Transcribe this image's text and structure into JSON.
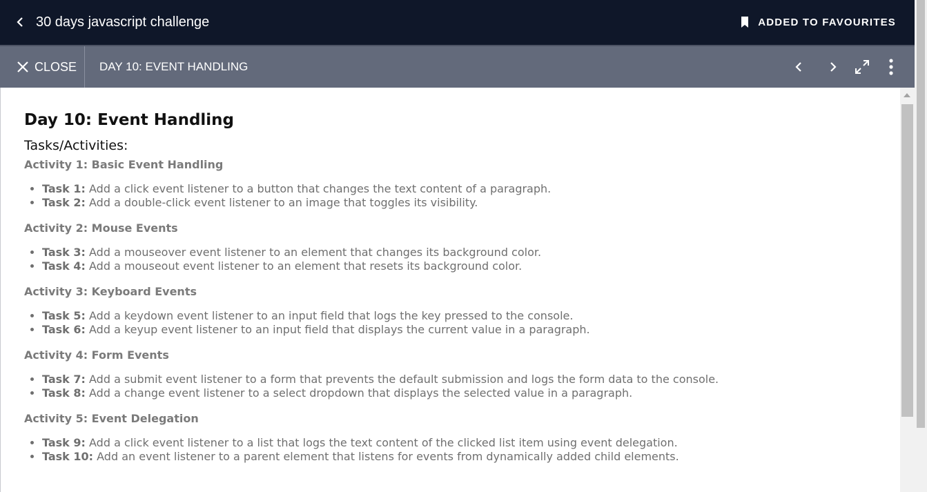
{
  "header": {
    "course_title": "30 days javascript challenge",
    "favourite_label": "ADDED TO FAVOURITES",
    "back_icon": "chevron-left-icon",
    "favourite_icon": "bookmark-icon"
  },
  "subbar": {
    "close_label": "CLOSE",
    "lesson_title": "DAY 10: EVENT HANDLING",
    "icons": [
      "chevron-left-icon",
      "chevron-right-icon",
      "expand-icon",
      "more-vertical-icon"
    ]
  },
  "content": {
    "title": "Day 10: Event Handling",
    "subtitle": "Tasks/Activities:",
    "activities": [
      {
        "heading": "Activity 1: Basic Event Handling",
        "tasks": [
          {
            "label": "Task 1:",
            "text": " Add a click event listener to a button that changes the text content of a paragraph."
          },
          {
            "label": "Task 2:",
            "text": " Add a double-click event listener to an image that toggles its visibility."
          }
        ]
      },
      {
        "heading": "Activity 2: Mouse Events",
        "tasks": [
          {
            "label": "Task 3:",
            "text": " Add a mouseover event listener to an element that changes its background color."
          },
          {
            "label": "Task 4:",
            "text": " Add a mouseout event listener to an element that resets its background color."
          }
        ]
      },
      {
        "heading": "Activity 3: Keyboard Events",
        "tasks": [
          {
            "label": "Task 5:",
            "text": " Add a keydown event listener to an input field that logs the key pressed to the console."
          },
          {
            "label": "Task 6:",
            "text": " Add a keyup event listener to an input field that displays the current value in a paragraph."
          }
        ]
      },
      {
        "heading": "Activity 4: Form Events",
        "tasks": [
          {
            "label": "Task 7:",
            "text": " Add a submit event listener to a form that prevents the default submission and logs the form data to the console."
          },
          {
            "label": "Task 8:",
            "text": " Add a change event listener to a select dropdown that displays the selected value in a paragraph."
          }
        ]
      },
      {
        "heading": "Activity 5: Event Delegation",
        "tasks": [
          {
            "label": "Task 9:",
            "text": " Add a click event listener to a list that logs the text content of the clicked list item using event delegation."
          },
          {
            "label": "Task 10:",
            "text": " Add an event listener to a parent element that listens for events from dynamically added child elements."
          }
        ]
      }
    ]
  },
  "colors": {
    "topbar_bg": "#0f1729",
    "subbar_bg": "#636a7b",
    "text_muted": "#6f6f6f",
    "text_dark": "#111111"
  }
}
